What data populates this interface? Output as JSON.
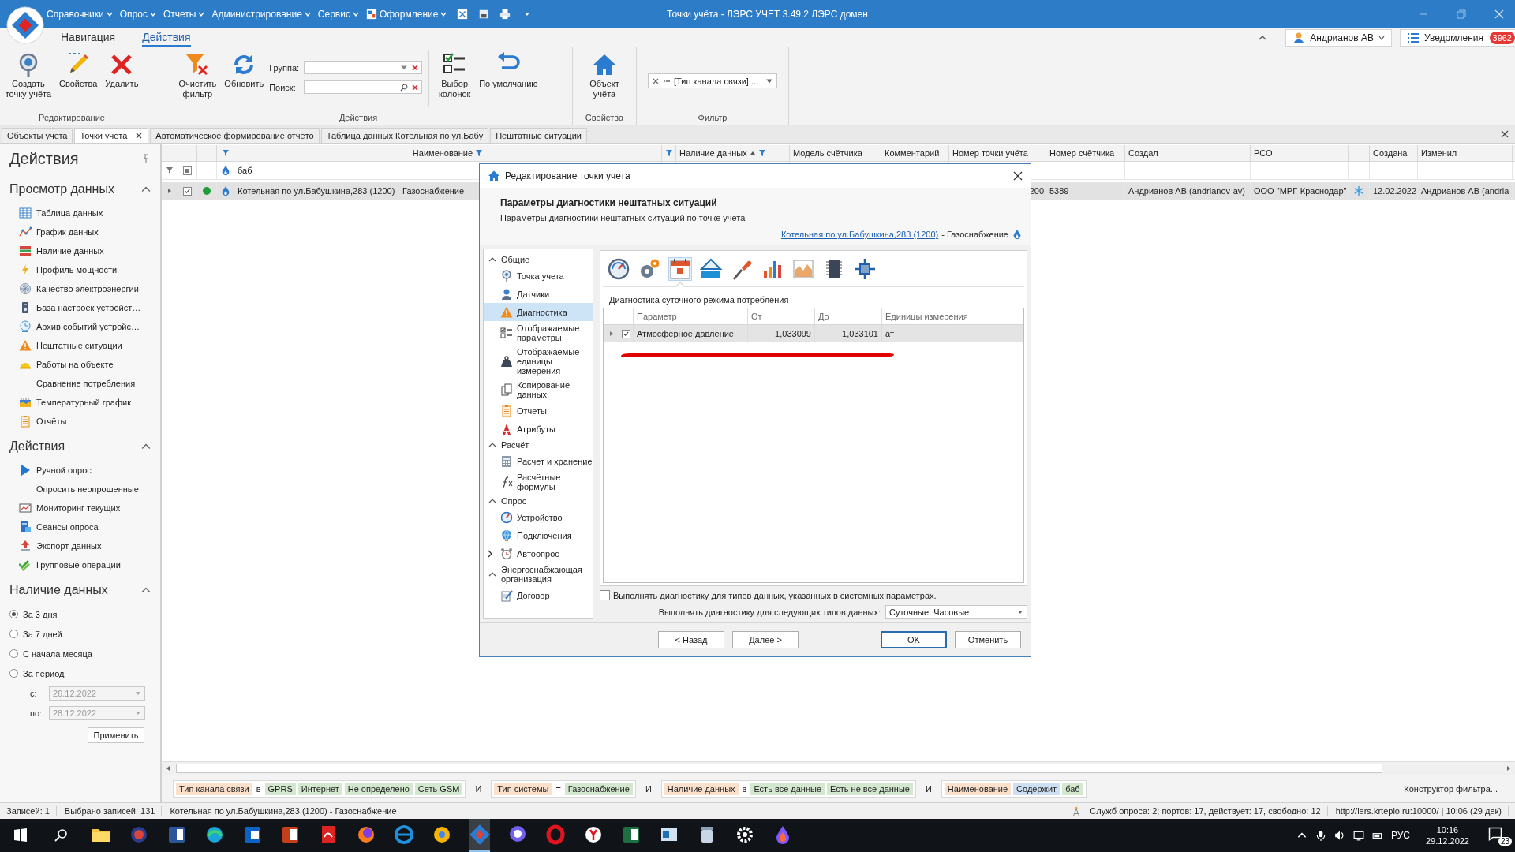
{
  "app": {
    "title": "Точки учёта - ЛЭРС УЧЕТ 3.49.2 ЛЭРС домен",
    "menu": [
      "Справочники",
      "Опрос",
      "Отчеты",
      "Администрирование",
      "Сервис",
      "Оформление"
    ]
  },
  "ribbon_tabs": [
    {
      "label": "Навигация",
      "selected": false
    },
    {
      "label": "Действия",
      "selected": true
    }
  ],
  "user": {
    "name": "Андрианов АВ"
  },
  "notifications": {
    "label": "Уведомления",
    "count": "3962"
  },
  "ribbon_groups": [
    {
      "title": "Редактирование",
      "items": [
        {
          "kind": "create",
          "label": "Создать\nточку учёта"
        },
        {
          "kind": "edit",
          "label": "Свойства"
        },
        {
          "kind": "delete",
          "label": "Удалить"
        }
      ]
    },
    {
      "title": "Действия",
      "items": [
        {
          "kind": "clear",
          "label": "Очистить\nфильтр"
        },
        {
          "kind": "refresh",
          "label": "Обновить"
        },
        {
          "kind": "fields",
          "fields": [
            {
              "kind": "combo",
              "label": "Группа:"
            },
            {
              "kind": "search",
              "label": "Поиск:"
            }
          ]
        },
        {
          "kind": "separator"
        },
        {
          "kind": "columns",
          "label": "Выбор\nколонок"
        },
        {
          "kind": "undo",
          "label": "По умолчанию"
        }
      ]
    },
    {
      "title": "Свойства",
      "items": [
        {
          "kind": "home",
          "label": "Объект\nучёта"
        }
      ]
    },
    {
      "title": "Фильтр",
      "items": [
        {
          "kind": "filter_combo",
          "label": "[Тип канала связи] ..."
        }
      ]
    }
  ],
  "doc_tabs": [
    {
      "label": "Объекты учета",
      "selected": false,
      "closable": false
    },
    {
      "label": "Точки учёта",
      "selected": true,
      "closable": true
    },
    {
      "label": "Автоматическое формирование отчёто",
      "selected": false,
      "closable": false
    },
    {
      "label": "Таблица данных Котельная по ул.Бабу",
      "selected": false,
      "closable": false
    },
    {
      "label": "Нештатные ситуации",
      "selected": false,
      "closable": false
    }
  ],
  "side_panel": {
    "title": "Действия",
    "sections": [
      {
        "title": "Просмотр данных",
        "expanded": true,
        "items": [
          {
            "kind": "table",
            "label": "Таблица данных"
          },
          {
            "kind": "chart",
            "label": "График данных"
          },
          {
            "kind": "bars",
            "label": "Наличие данных"
          },
          {
            "kind": "bolt",
            "label": "Профиль мощности"
          },
          {
            "kind": "power",
            "label": "Качество электроэнергии"
          },
          {
            "kind": "device",
            "label": "База настроек устройст…"
          },
          {
            "kind": "clock",
            "label": "Архив событий устройс…"
          },
          {
            "kind": "warning",
            "label": "Нештатные ситуации"
          },
          {
            "kind": "helmet",
            "label": "Работы на объекте"
          },
          {
            "kind": "none",
            "label": "Сравнение потребления"
          },
          {
            "kind": "thermo",
            "label": "Температурный график"
          },
          {
            "kind": "report",
            "label": "Отчёты"
          }
        ]
      },
      {
        "title": "Действия",
        "expanded": true,
        "items": [
          {
            "kind": "play",
            "label": "Ручной опрос"
          },
          {
            "kind": "none",
            "label": "Опросить неопрошенные"
          },
          {
            "kind": "monitor",
            "label": "Мониторинг текущих"
          },
          {
            "kind": "sessions",
            "label": "Сеансы опроса"
          },
          {
            "kind": "export",
            "label": "Экспорт данных"
          },
          {
            "kind": "check",
            "label": "Групповые операции"
          }
        ]
      },
      {
        "title": "Наличие данных",
        "expanded": true,
        "radios": [
          {
            "label": "За 3 дня",
            "selected": true
          },
          {
            "label": "За 7 дней",
            "selected": false
          },
          {
            "label": "С начала месяца",
            "selected": false
          },
          {
            "label": "За период",
            "selected": false
          }
        ],
        "dates": [
          {
            "label": "с:",
            "value": "26.12.2022",
            "disabled": true
          },
          {
            "label": "по:",
            "value": "28.12.2022",
            "disabled": true
          }
        ],
        "apply": "Применить"
      }
    ]
  },
  "grid": {
    "columns": [
      {
        "label": "Наименование",
        "filtered": true,
        "sorted": false,
        "value": "Котельная по ул.Бабушкина,283 (1200) - Газоснабжение"
      },
      {
        "label": "Наличие данных",
        "filtered": true,
        "sorted": true
      },
      {
        "label": "Модель счётчика",
        "filtered": false,
        "sorted": false
      },
      {
        "label": "Комментарий",
        "filtered": false,
        "sorted": false
      },
      {
        "label": "Номер точки учёта",
        "filtered": false,
        "sorted": false,
        "value": "200"
      },
      {
        "label": "Номер счётчика",
        "filtered": false,
        "sorted": false,
        "value": "5389"
      },
      {
        "label": "Создал",
        "filtered": false,
        "sorted": false,
        "value": "Андрианов АВ (andrianov-av)"
      },
      {
        "label": "РСО",
        "filtered": false,
        "sorted": false,
        "value": "ООО \"МРГ-Краснодар\""
      },
      {
        "label": "Создана",
        "filtered": false,
        "sorted": false,
        "value": "12.02.2022"
      },
      {
        "label": "Изменил",
        "filtered": false,
        "sorted": false,
        "value": "Андрианов АВ (andria"
      }
    ],
    "filter_value": "баб",
    "select_all_indeterminate": true,
    "row": {
      "selected": true,
      "checked": true,
      "expanded": false,
      "color": "#1e9e3a"
    }
  },
  "filter_bar": {
    "conditions": [
      {
        "parts": [
          {
            "kind": "field",
            "text": "Тип канала связи"
          },
          {
            "kind": "op",
            "text": "в"
          },
          {
            "kind": "value",
            "text": "GPRS"
          },
          {
            "kind": "value",
            "text": "Интернет"
          },
          {
            "kind": "value",
            "text": "Не определено"
          },
          {
            "kind": "value",
            "text": "Сеть GSM"
          }
        ]
      },
      {
        "joiner": "И",
        "parts": [
          {
            "kind": "field",
            "text": "Тип системы"
          },
          {
            "kind": "op",
            "text": "="
          },
          {
            "kind": "value",
            "text": "Газоснабжение"
          }
        ]
      },
      {
        "joiner": "И",
        "parts": [
          {
            "kind": "field",
            "text": "Наличие данных"
          },
          {
            "kind": "op",
            "text": "в"
          },
          {
            "kind": "value",
            "text": "Есть все данные"
          },
          {
            "kind": "value",
            "text": "Есть не все данные"
          }
        ]
      },
      {
        "joiner": "И",
        "parts": [
          {
            "kind": "field",
            "text": "Наименование"
          },
          {
            "kind": "operator",
            "text": "Содержит"
          },
          {
            "kind": "value",
            "text": "баб"
          }
        ]
      }
    ],
    "builder": "Конструктор фильтра..."
  },
  "status_bar": {
    "records": "Записей: 1",
    "selected": "Выбрано записей: 131",
    "current": "Котельная по ул.Бабушкина,283 (1200) - Газоснабжение",
    "services": "Служб опроса: 2; портов: 17, действует: 17, свободно: 12",
    "server": "http://lers.krteplo.ru:10000/ | 10:06 (29 дек)"
  },
  "dialog": {
    "title": "Редактирование точки учета",
    "heading": "Параметры диагностики нештатных ситуаций",
    "subheading": "Параметры диагностики нештатных ситуаций по точке учета",
    "object_link": "Котельная по ул.Бабушкина,283 (1200)",
    "object_suffix": "- Газоснабжение",
    "nav": [
      {
        "label": "Общие",
        "expanded": true,
        "children": [
          {
            "kind": "point",
            "label": "Точка учета",
            "selected": false,
            "collapsed": false
          },
          {
            "kind": "sensor",
            "label": "Датчики",
            "selected": false,
            "collapsed": false
          },
          {
            "kind": "warning",
            "label": "Диагностика",
            "selected": true,
            "collapsed": false
          },
          {
            "kind": "params",
            "label": "Отображаемые\nпараметры",
            "selected": false,
            "collapsed": false
          },
          {
            "kind": "units",
            "label": "Отображаемые\nединицы\nизмерения",
            "selected": false,
            "collapsed": false
          },
          {
            "kind": "copy",
            "label": "Копирование\nданных",
            "selected": false,
            "collapsed": false
          },
          {
            "kind": "report",
            "label": "Отчеты",
            "selected": false,
            "collapsed": false
          },
          {
            "kind": "attrs",
            "label": "Атрибуты",
            "selected": false,
            "collapsed": false
          }
        ]
      },
      {
        "label": "Расчёт",
        "expanded": true,
        "children": [
          {
            "kind": "calc",
            "label": "Расчет и хранение",
            "selected": false,
            "collapsed": false
          },
          {
            "kind": "formula",
            "label": "Расчётные\nформулы",
            "selected": false,
            "collapsed": false
          }
        ]
      },
      {
        "label": "Опрос",
        "expanded": true,
        "children": [
          {
            "kind": "device",
            "label": "Устройство",
            "selected": false,
            "collapsed": false
          },
          {
            "kind": "globe",
            "label": "Подключения",
            "selected": false,
            "collapsed": false
          },
          {
            "kind": "alarm",
            "label": "Автоопрос",
            "selected": false,
            "collapsed": true
          }
        ]
      },
      {
        "label": "Энергоснабжающая\nорганизация",
        "expanded": true,
        "children": [
          {
            "kind": "contract",
            "label": "Договор",
            "selected": false,
            "collapsed": false
          }
        ]
      }
    ],
    "toolbar": [
      {
        "kind": "gauge",
        "selected": false
      },
      {
        "kind": "gears",
        "selected": false
      },
      {
        "kind": "calendar",
        "selected": true
      },
      {
        "kind": "water",
        "selected": false
      },
      {
        "kind": "screwdriver",
        "selected": false
      },
      {
        "kind": "bars",
        "selected": false
      },
      {
        "kind": "area",
        "selected": false
      },
      {
        "kind": "chip",
        "selected": false
      },
      {
        "kind": "target",
        "selected": false
      }
    ],
    "section_title": "Диагностика суточного режима потребления",
    "table": {
      "columns": [
        "Параметр",
        "От",
        "До",
        "Единицы измерения"
      ],
      "rows": [
        {
          "selected": true,
          "checked": true,
          "expanded": false,
          "cells": [
            "Атмосферное давление",
            "1,033099",
            "1,033101",
            "ат"
          ]
        }
      ]
    },
    "system_types": {
      "label": "Выполнять диагностику для типов данных, указанных в системных параметрах.",
      "checked": false
    },
    "types": {
      "label": "Выполнять диагностику для следующих типов данных:",
      "value": "Суточные, Часовые"
    },
    "buttons": [
      {
        "label": "< Назад",
        "default": false
      },
      {
        "label": "Далее >",
        "default": false
      },
      {
        "label": "OK",
        "default": true
      },
      {
        "label": "Отменить",
        "default": false
      }
    ]
  },
  "taskbar": {
    "lang": "РУС",
    "time": "10:16",
    "date": "29.12.2022",
    "notifications": "23"
  }
}
